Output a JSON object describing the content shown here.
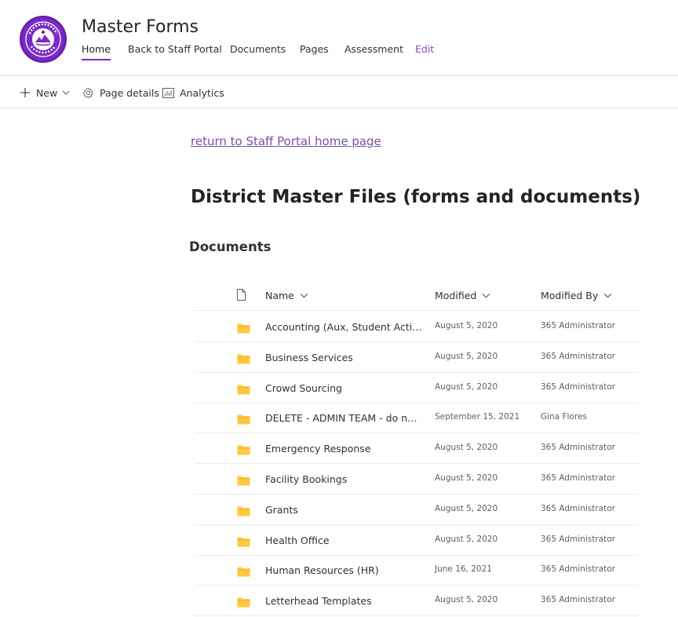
{
  "header": {
    "site_title": "Master Forms",
    "nav": [
      {
        "label": "Home",
        "active": true
      },
      {
        "label": "Back to Staff Portal"
      },
      {
        "label": "Documents"
      },
      {
        "label": "Pages"
      },
      {
        "label": "Assessment"
      },
      {
        "label": "Edit"
      }
    ],
    "colors": {
      "brand": "#7a2bc4",
      "edit_link": "#8a49c9"
    }
  },
  "command_bar": {
    "new_label": "New",
    "page_details_label": "Page details",
    "analytics_label": "Analytics"
  },
  "content": {
    "return_link": "return to Staff Portal home page",
    "page_heading": "District Master Files (forms and documents)",
    "section_heading": "Documents"
  },
  "library": {
    "columns": {
      "name": "Name",
      "modified": "Modified",
      "modified_by": "Modified By"
    },
    "rows": [
      {
        "name": "Accounting (Aux, Student Activities...",
        "modified": "August 5, 2020",
        "modified_by": "365 Administrator"
      },
      {
        "name": "Business Services",
        "modified": "August 5, 2020",
        "modified_by": "365 Administrator"
      },
      {
        "name": "Crowd Sourcing",
        "modified": "August 5, 2020",
        "modified_by": "365 Administrator"
      },
      {
        "name": "DELETE - ADMIN TEAM - do not ...",
        "modified": "September 15, 2021",
        "modified_by": "Gina Flores"
      },
      {
        "name": "Emergency Response",
        "modified": "August 5, 2020",
        "modified_by": "365 Administrator"
      },
      {
        "name": "Facility Bookings",
        "modified": "August 5, 2020",
        "modified_by": "365 Administrator"
      },
      {
        "name": "Grants",
        "modified": "August 5, 2020",
        "modified_by": "365 Administrator"
      },
      {
        "name": "Health Office",
        "modified": "August 5, 2020",
        "modified_by": "365 Administrator"
      },
      {
        "name": "Human Resources (HR)",
        "modified": "June 16, 2021",
        "modified_by": "365 Administrator"
      },
      {
        "name": "Letterhead Templates",
        "modified": "August 5, 2020",
        "modified_by": "365 Administrator"
      }
    ],
    "folder_color": "#ffc83d"
  }
}
